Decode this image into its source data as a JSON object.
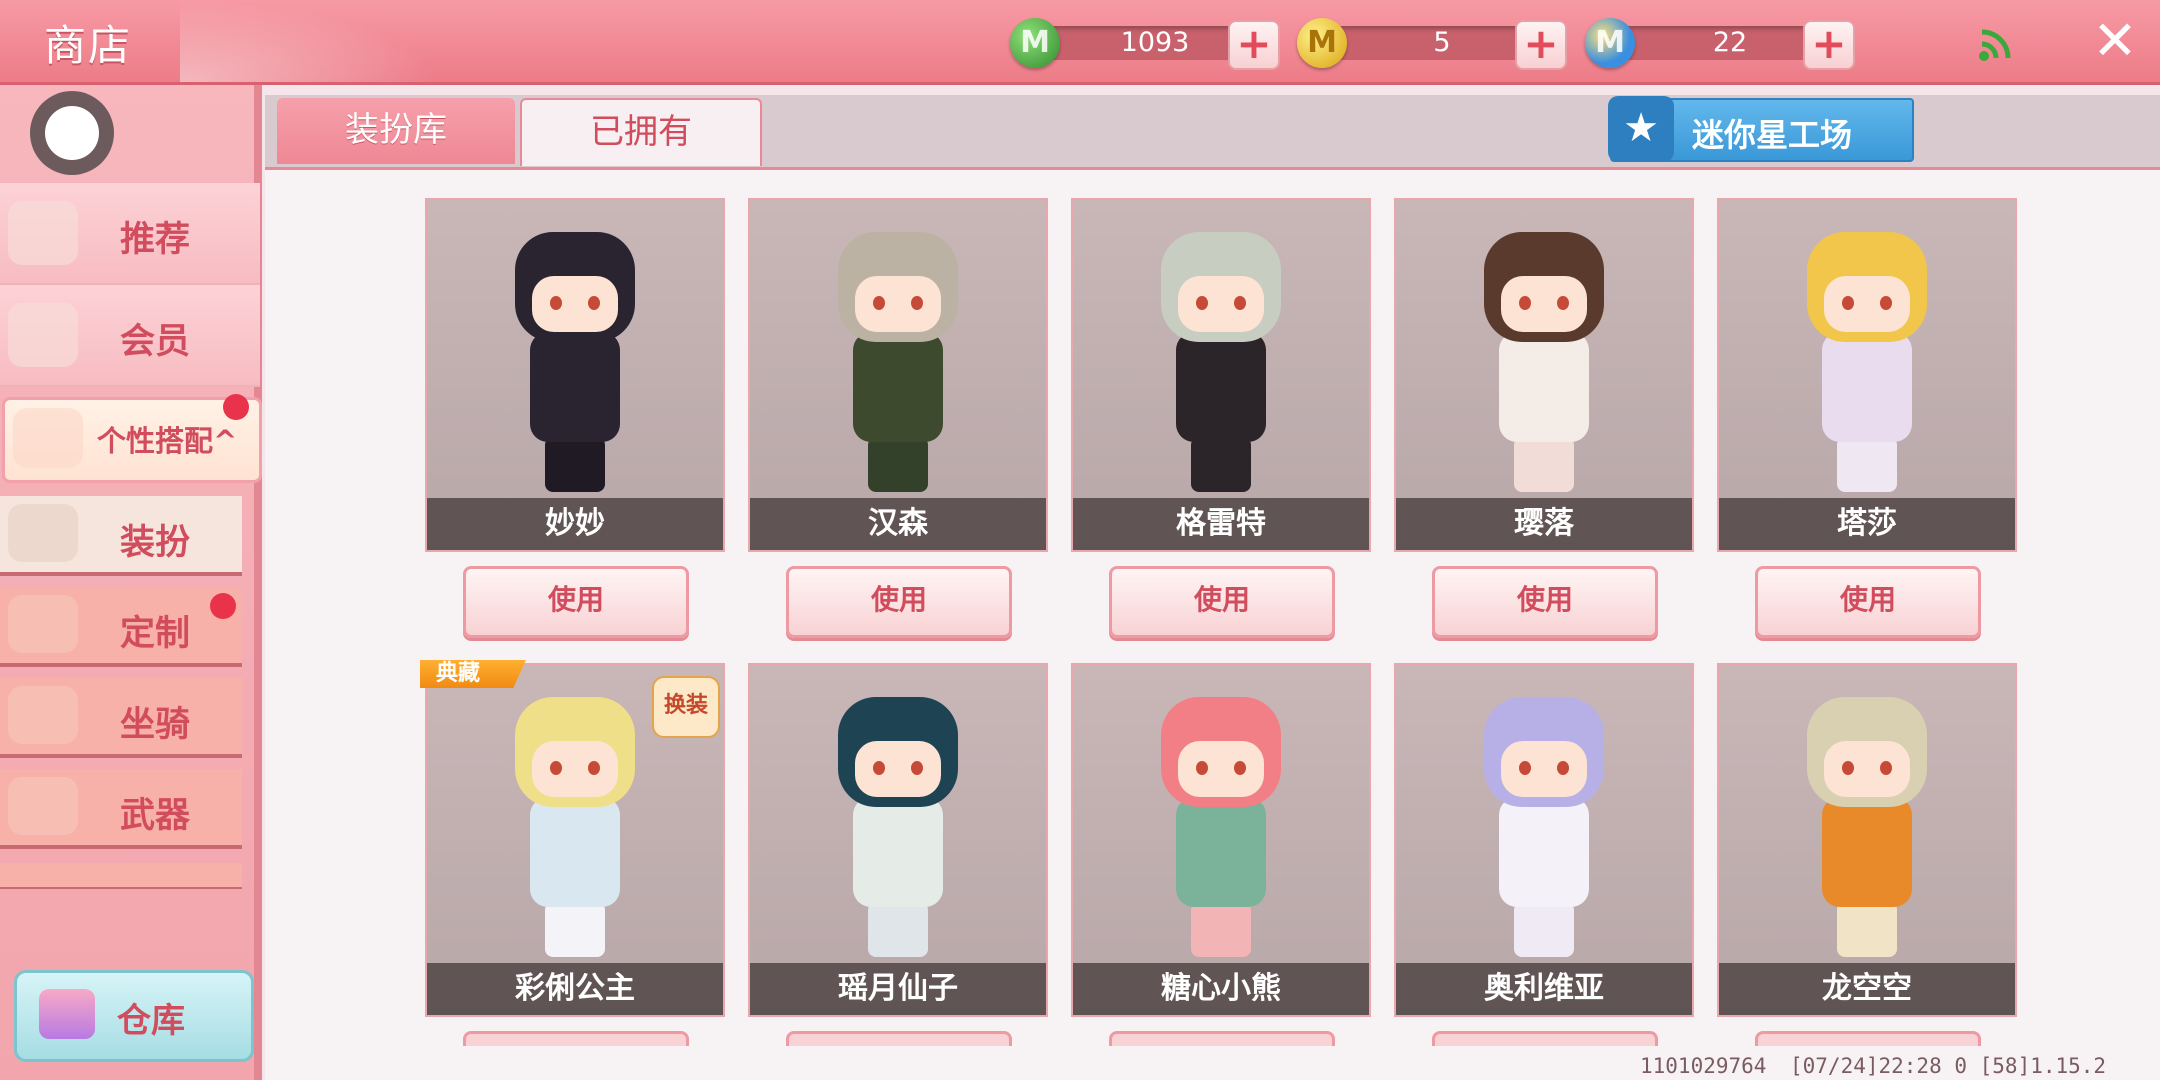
{
  "header": {
    "title": "商店",
    "currencies": [
      {
        "icon": "green-m-coin-icon",
        "letter": "M",
        "value": "1093",
        "color": "#3d9b3a"
      },
      {
        "icon": "gold-m-coin-icon",
        "letter": "M",
        "value": "5",
        "color": "#e0b21a"
      },
      {
        "icon": "blue-m-coin-icon",
        "letter": "M",
        "value": "22",
        "color": "#3a8fe0"
      }
    ],
    "plus_label": "+",
    "close_label": "✕"
  },
  "sidebar": {
    "main_items": [
      {
        "label": "推荐",
        "icon": "thumbs-up-icon"
      },
      {
        "label": "会员",
        "icon": "member-icon"
      }
    ],
    "expanded_item": {
      "label": "个性搭配",
      "icon": "star-gear-icon",
      "arrow": "^"
    },
    "sub_items": [
      {
        "label": "装扮",
        "icon": "shirt-icon"
      },
      {
        "label": "定制",
        "icon": "pencil-icon"
      },
      {
        "label": "坐骑",
        "icon": "mount-icon"
      },
      {
        "label": "武器",
        "icon": "gun-icon"
      }
    ],
    "warehouse_label": "仓库"
  },
  "tabs": [
    {
      "label": "装扮库",
      "active": false
    },
    {
      "label": "已拥有",
      "active": true
    }
  ],
  "mini_works_button": {
    "label": "迷你星工场",
    "icon": "star-icon",
    "glyph": "★"
  },
  "use_label": "使用",
  "badges": {
    "diancang": "典藏",
    "exchange": "换装"
  },
  "skins": [
    {
      "name": "妙妙",
      "hair": "#2a2430",
      "outfit": "#2a2430",
      "legs": "#1f1a24"
    },
    {
      "name": "汉森",
      "hair": "#bcb2a4",
      "outfit": "#3e4a2e",
      "legs": "#33402a"
    },
    {
      "name": "格雷特",
      "hair": "#c7cdc0",
      "outfit": "#2b2428",
      "legs": "#2b2428"
    },
    {
      "name": "璎落",
      "hair": "#5a3a2c",
      "outfit": "#f4ece6",
      "legs": "#f2dcd8"
    },
    {
      "name": "塔莎",
      "hair": "#f2c64a",
      "outfit": "#e9dcef",
      "legs": "#efe7f2"
    },
    {
      "name": "彩俐公主",
      "hair": "#eedf88",
      "outfit": "#d9e8f0",
      "legs": "#f4f4f8"
    },
    {
      "name": "瑶月仙子",
      "hair": "#1e4454",
      "outfit": "#e5ece8",
      "legs": "#dfe5e9"
    },
    {
      "name": "糖心小熊",
      "hair": "#f27f86",
      "outfit": "#7ab39a",
      "legs": "#f2b4b4"
    },
    {
      "name": "奥利维亚",
      "hair": "#b7b0e6",
      "outfit": "#f4f1f8",
      "legs": "#efeaf4"
    },
    {
      "name": "龙空空",
      "hair": "#d9d0b2",
      "outfit": "#e98a2a",
      "legs": "#f1e3c5"
    }
  ],
  "footer": {
    "user_id": "1101029764",
    "info": "[07/24]22:28 0 [58]1.15.2"
  }
}
